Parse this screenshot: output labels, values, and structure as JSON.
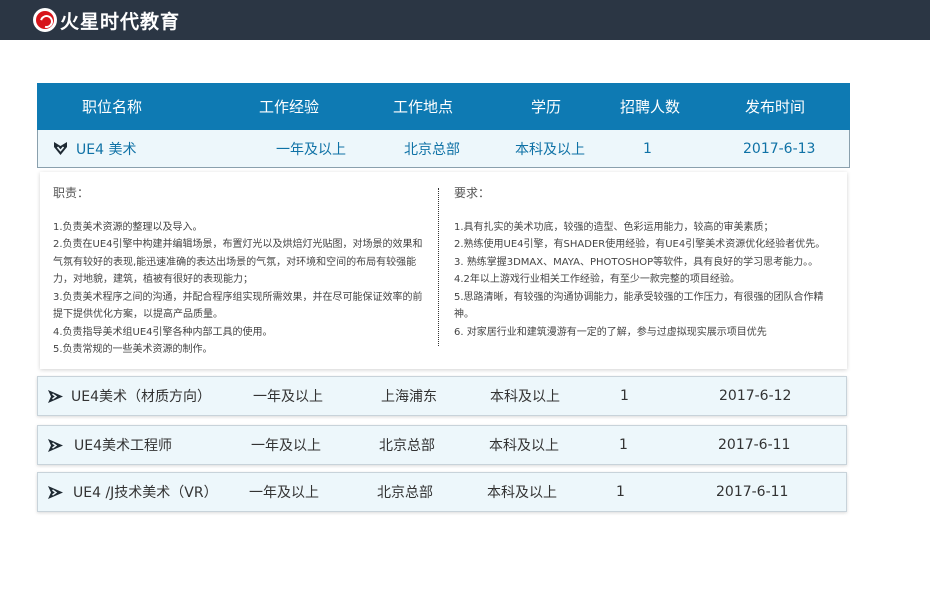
{
  "brand": {
    "name": "火星时代教育"
  },
  "table": {
    "headers": [
      "职位名称",
      "工作经验",
      "工作地点",
      "学历",
      "招聘人数",
      "发布时间"
    ]
  },
  "jobs": [
    {
      "title": "UE4 美术",
      "experience": "一年及以上",
      "location": "北京总部",
      "education": "本科及以上",
      "count": "1",
      "date": "2017-6-13",
      "expanded": true
    },
    {
      "title": "UE4美术（材质方向）",
      "experience": "一年及以上",
      "location": "上海浦东",
      "education": "本科及以上",
      "count": "1",
      "date": "2017-6-12",
      "expanded": false
    },
    {
      "title": "UE4美术工程师",
      "experience": "一年及以上",
      "location": "北京总部",
      "education": "本科及以上",
      "count": "1",
      "date": "2017-6-11",
      "expanded": false
    },
    {
      "title": "UE4 /J技术美术（VR）",
      "experience": "一年及以上",
      "location": "北京总部",
      "education": "本科及以上",
      "count": "1",
      "date": "2017-6-11",
      "expanded": false
    }
  ],
  "detail": {
    "duties_title": "职责：",
    "duties": [
      "1.负责美术资源的整理以及导入。",
      "2.负责在UE4引擎中构建并编辑场景，布置灯光以及烘焙灯光贴图，对场景的效果和",
      "气氛有较好的表现,能迅速准确的表达出场景的气氛，对环境和空间的布局有较强能",
      "力，对地貌，建筑，植被有很好的表现能力；",
      "3.负责美术程序之间的沟通，并配合程序组实现所需效果，并在尽可能保证效率的前",
      "提下提供优化方案，以提高产品质量。",
      "4.负责指导美术组UE4引擎各种内部工具的使用。",
      "5.负责常规的一些美术资源的制作。"
    ],
    "requirements_title": "要求：",
    "requirements": [
      "1.具有扎实的美术功底，较强的造型、色彩运用能力，较高的审美素质；",
      "2.熟练使用UE4引擎，有SHADER使用经验，有UE4引擎美术资源优化经验者优先。",
      "3. 熟练掌握3DMAX、MAYA、PHOTOSHOP等软件，具有良好的学习思考能力。。",
      "4.2年以上游戏行业相关工作经验，有至少一款完整的项目经验。",
      "5.思路清晰，有较强的沟通协调能力，能承受较强的工作压力，有很强的团队合作精",
      "神。",
      "6. 对家居行业和建筑漫游有一定的了解，参与过虚拟现实展示项目优先"
    ]
  },
  "colors": {
    "topbar": "#2b3644",
    "header": "#0e7ab3",
    "accent_text": "#0f72a6",
    "row_bg": "#edf7fb",
    "brand_red": "#d7141a"
  }
}
